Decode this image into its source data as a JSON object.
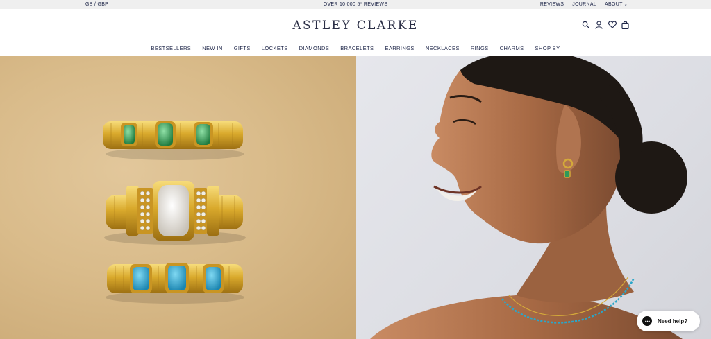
{
  "topbar": {
    "currency": "GB / GBP",
    "promo": "OVER 10,000 5* REVIEWS",
    "links": [
      "REVIEWS",
      "JOURNAL",
      "ABOUT"
    ]
  },
  "header": {
    "logo": "ASTLEY CLARKE",
    "icons": [
      "search-icon",
      "account-icon",
      "wishlist-icon",
      "bag-icon"
    ]
  },
  "nav": [
    "BESTSELLERS",
    "NEW IN",
    "GIFTS",
    "LOCKETS",
    "DIAMONDS",
    "BRACELETS",
    "EARRINGS",
    "NECKLACES",
    "RINGS",
    "CHARMS",
    "SHOP BY"
  ],
  "chat": {
    "label": "Need help?"
  },
  "colors": {
    "navy": "#1c2447",
    "gold": "#d4a93a",
    "green_stone": "#2f9a5a",
    "turquoise": "#2aa6c9",
    "background_tan": "#d9bb8a"
  }
}
